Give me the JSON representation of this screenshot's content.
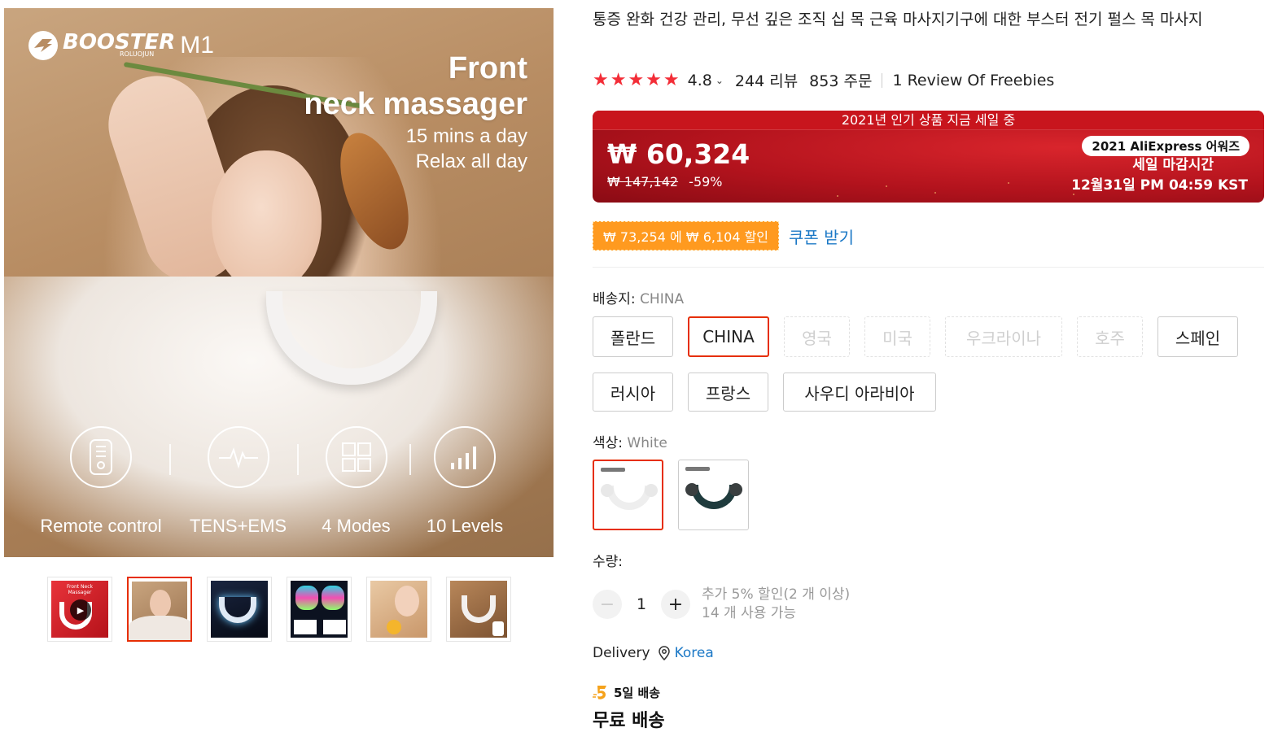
{
  "gallery": {
    "brand_name": "BOOSTER",
    "brand_sub": "ROLUOJUN",
    "brand_model": "M1",
    "headline_line1": "Front",
    "headline_line2": "neck massager",
    "sub_line1": "15 mins a day",
    "sub_line2": "Relax all day",
    "features": [
      {
        "label": "Remote control",
        "icon": "remote-icon"
      },
      {
        "label": "TENS+EMS",
        "icon": "pulse-icon"
      },
      {
        "label": "4 Modes",
        "icon": "grid-icon"
      },
      {
        "label": "10 Levels",
        "icon": "bars-icon"
      }
    ],
    "thumbnails": [
      {
        "caption": "Front Neck Massager",
        "has_video": true
      },
      {
        "caption": "",
        "has_video": false,
        "selected": true
      },
      {
        "caption": "",
        "has_video": false
      },
      {
        "caption": "",
        "has_video": false
      },
      {
        "caption": "",
        "has_video": false
      },
      {
        "caption": "",
        "has_video": false
      }
    ]
  },
  "product": {
    "title": "통증 완화 건강 관리, 무선 깊은 조직 십 목 근육 마사지기구에 대한 부스터 전기 펄스 목 마사지",
    "stars": "★★★★★",
    "rating": "4.8",
    "reviews": "244 리뷰",
    "orders": "853 주문",
    "freebies": "1 Review Of Freebies"
  },
  "sale": {
    "banner_title": "2021년 인기 상품 지금 세일 중",
    "price": "₩ 60,324",
    "original_price": "₩ 147,142",
    "discount": "-59%",
    "award": "2021 AliExpress 어워즈",
    "ends_label": "세일 마감시간",
    "ends_time": "12월31일 PM 04:59 KST"
  },
  "coupon": {
    "tag": "₩ 73,254 에 ₩ 6,104 할인",
    "link": "쿠폰 받기"
  },
  "ship_from": {
    "label": "배송지:",
    "value": "CHINA",
    "options": [
      {
        "label": "폴란드",
        "state": "normal"
      },
      {
        "label": "CHINA",
        "state": "selected"
      },
      {
        "label": "영국",
        "state": "disabled"
      },
      {
        "label": "미국",
        "state": "disabled"
      },
      {
        "label": "우크라이나",
        "state": "disabled"
      },
      {
        "label": "호주",
        "state": "disabled"
      },
      {
        "label": "스페인",
        "state": "normal"
      },
      {
        "label": "러시아",
        "state": "normal"
      },
      {
        "label": "프랑스",
        "state": "normal"
      },
      {
        "label": "사우디 아라비아",
        "state": "normal"
      }
    ]
  },
  "color": {
    "label": "색상:",
    "value": "White",
    "options": [
      {
        "name": "White",
        "selected": true
      },
      {
        "name": "Dark Green",
        "selected": false
      }
    ]
  },
  "quantity": {
    "label": "수량:",
    "value": "1",
    "minus": "−",
    "plus": "+",
    "note_line1": "추가 5% 할인(2 개 이상)",
    "note_line2": "14 개 사용 가능"
  },
  "delivery": {
    "label": "Delivery",
    "destination": "Korea",
    "fast_badge": "5일 배송",
    "free_shipping": "무료 배송"
  },
  "colors": {
    "accent_red": "#e62e04",
    "star_red": "#f32d37",
    "link_blue": "#1b78c6",
    "coupon_orange": "#ff9a1f"
  }
}
